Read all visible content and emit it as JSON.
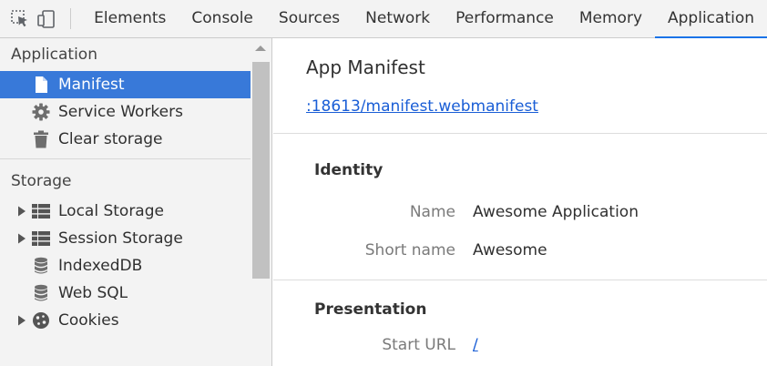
{
  "toolbar": {
    "icons": [
      "inspect-element-icon",
      "device-toggle-icon"
    ],
    "tabs": [
      {
        "label": "Elements"
      },
      {
        "label": "Console"
      },
      {
        "label": "Sources"
      },
      {
        "label": "Network"
      },
      {
        "label": "Performance"
      },
      {
        "label": "Memory"
      },
      {
        "label": "Application",
        "active": true
      }
    ]
  },
  "sidebar": {
    "application": {
      "title": "Application",
      "items": [
        {
          "label": "Manifest",
          "icon": "document-icon",
          "selected": true
        },
        {
          "label": "Service Workers",
          "icon": "gear-icon"
        },
        {
          "label": "Clear storage",
          "icon": "trash-icon"
        }
      ]
    },
    "storage": {
      "title": "Storage",
      "items": [
        {
          "label": "Local Storage",
          "icon": "grid-icon",
          "expandable": true
        },
        {
          "label": "Session Storage",
          "icon": "grid-icon",
          "expandable": true
        },
        {
          "label": "IndexedDB",
          "icon": "database-icon"
        },
        {
          "label": "Web SQL",
          "icon": "database-icon"
        },
        {
          "label": "Cookies",
          "icon": "cookie-icon",
          "expandable": true
        }
      ]
    }
  },
  "main": {
    "title": "App Manifest",
    "manifest_link": ":18613/manifest.webmanifest",
    "identity": {
      "title": "Identity",
      "name_label": "Name",
      "name_value": "Awesome Application",
      "short_name_label": "Short name",
      "short_name_value": "Awesome"
    },
    "presentation": {
      "title": "Presentation",
      "start_url_label": "Start URL",
      "start_url_value": "/"
    }
  },
  "colors": {
    "selected_bg": "#3879d9",
    "active_tab_underline": "#1a73e8",
    "link": "#1a5ed6"
  }
}
